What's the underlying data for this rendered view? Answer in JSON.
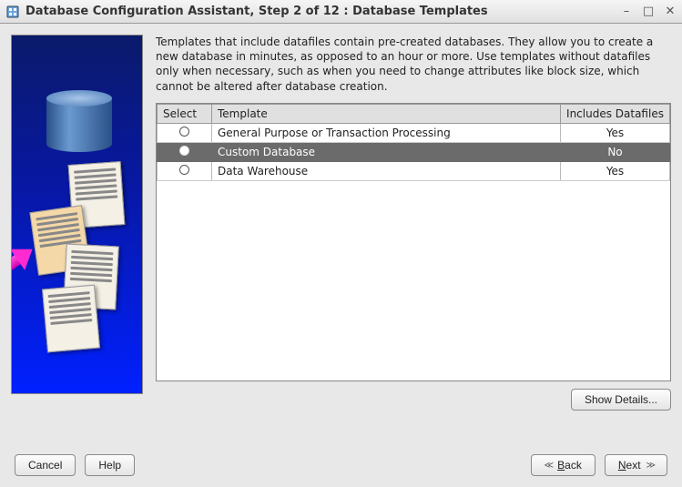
{
  "window": {
    "title": "Database Configuration Assistant, Step 2 of 12 : Database Templates"
  },
  "description": "Templates that include datafiles contain pre-created databases. They allow you to create a new database in minutes, as opposed to an hour or more. Use templates without datafiles only when necessary, such as when you need to change attributes like block size, which cannot be altered after database creation.",
  "columns": {
    "select": "Select",
    "template": "Template",
    "includes": "Includes Datafiles"
  },
  "rows": [
    {
      "template": "General Purpose or Transaction Processing",
      "includes": "Yes",
      "selected": false
    },
    {
      "template": "Custom Database",
      "includes": "No",
      "selected": true
    },
    {
      "template": "Data Warehouse",
      "includes": "Yes",
      "selected": false
    }
  ],
  "buttons": {
    "show_details": "Show Details...",
    "cancel": "Cancel",
    "help": "Help",
    "back": "ack",
    "back_mnemonic": "B",
    "next": "ext",
    "next_mnemonic": "N"
  }
}
